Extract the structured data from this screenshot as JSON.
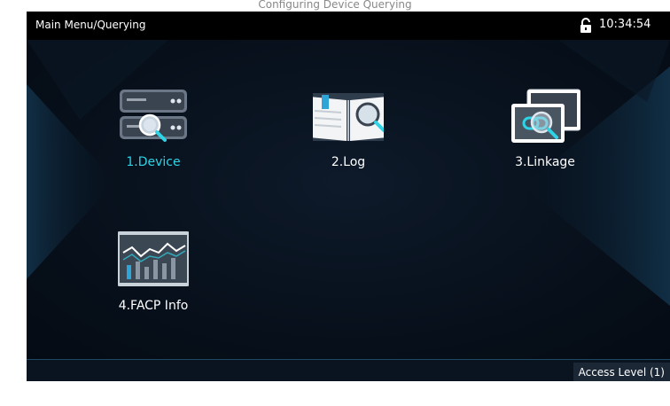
{
  "window_caption": "Configuring Device Querying",
  "header": {
    "breadcrumb": "Main Menu/Querying",
    "lock_icon": "unlocked-padlock-icon",
    "time": "10:34:54"
  },
  "menu": {
    "items": [
      {
        "label": "1.Device",
        "icon": "server-search-icon",
        "selected": true,
        "color": "#2ed3e6"
      },
      {
        "label": "2.Log",
        "icon": "book-search-icon",
        "selected": false
      },
      {
        "label": "3.Linkage",
        "icon": "linkage-search-icon",
        "selected": false
      },
      {
        "label": "4.FACP Info",
        "icon": "monitor-chart-icon",
        "selected": false
      }
    ]
  },
  "status": {
    "access_level": "Access Level  (1)"
  },
  "colors": {
    "background": "#07101b",
    "accent": "#2ed3e6",
    "topbar": "#000000"
  }
}
